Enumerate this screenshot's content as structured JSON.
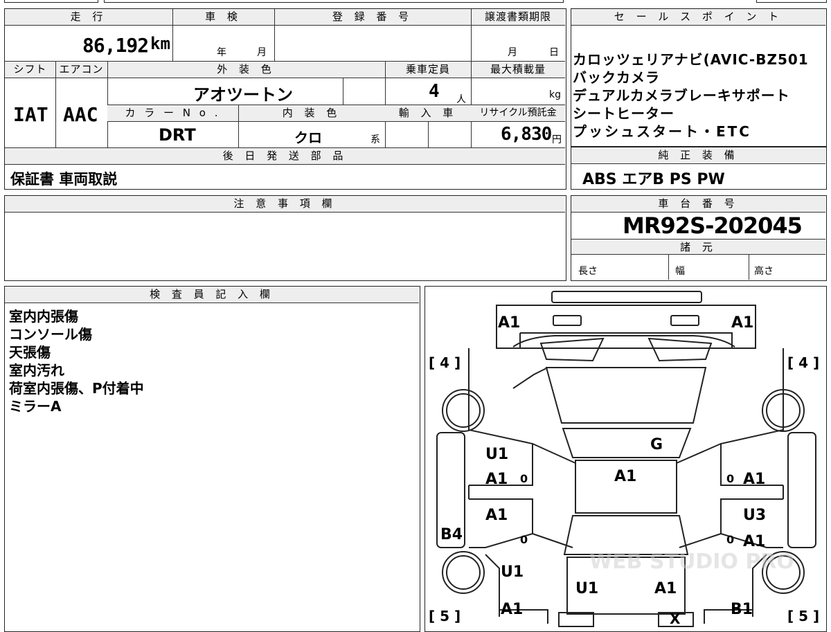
{
  "vehicle": {
    "headers": {
      "mileage": "走 行",
      "inspection": "車 検",
      "registration": "登 録 番 号",
      "transfer_deadline": "譲渡書類期限",
      "shift": "シフト",
      "aircon": "エアコン",
      "exterior_color": "外 装 色",
      "capacity": "乗車定員",
      "max_load": "最大積載量",
      "color_no": "カ ラ ー N o .",
      "interior_color": "内 装 色",
      "import": "輸 入 車",
      "recycle_fee": "リサイクル預託金"
    },
    "mileage": "86,192",
    "mileage_unit": "km",
    "inspection_year": "年",
    "inspection_month": "月",
    "deadline_month": "月",
    "deadline_day": "日",
    "shift": "IAT",
    "aircon": "AAC",
    "exterior_color": "アオツートン",
    "capacity": "4",
    "capacity_unit": "人",
    "max_load_unit": "kg",
    "color_no": "DRT",
    "interior_color": "クロ",
    "interior_suffix": "系",
    "recycle_fee": "6,830",
    "recycle_unit": "円"
  },
  "later_parts": {
    "header": "後 日 発 送 部 品",
    "value": "保証書 車両取説"
  },
  "selling_points": {
    "header": "セ ー ル ス ポ イ ン ト",
    "lines": [
      "カロッツェリアナビ(AVIC-BZ501",
      "バックカメラ",
      "デュアルカメラブレーキサポート",
      "シートヒーター",
      "プッシュスタート・ETC"
    ]
  },
  "standard_equipment": {
    "header": "純 正 装 備",
    "value": "ABS エアB PS PW"
  },
  "caution": {
    "header": "注 意 事 項 欄"
  },
  "chassis": {
    "header": "車 台 番 号",
    "value": "MR92S-202045"
  },
  "specs": {
    "header": "諸 元",
    "length": "長さ",
    "width": "幅",
    "height": "高さ"
  },
  "inspector": {
    "header": "検 査 員 記 入 欄",
    "lines": [
      "室内内張傷",
      "コンソール傷",
      "天張傷",
      "室内汚れ",
      "荷室内張傷、P付着中",
      "ミラーA"
    ]
  },
  "diagram": {
    "tire_left_front": "[ 4 ]",
    "tire_right_front": "[ 4 ]",
    "tire_left_rear": "[ 5 ]",
    "tire_right_rear": "[ 5 ]",
    "marks": {
      "bumper_front_left": "A1",
      "bumper_front_right": "A1",
      "windshield": "G",
      "roof": "A1",
      "left_front_door_1": "U1",
      "left_front_door_2": "A1",
      "left_rear_door": "A1",
      "left_rocker": "B4",
      "left_rear_fender": "U1",
      "left_rear_corner": "A1",
      "right_front_door": "A1",
      "right_rear_door_1": "U3",
      "right_rear_door_2": "A1",
      "rear_left": "U1",
      "rear_right": "A1",
      "right_rear_corner": "B1",
      "rear_x": "X",
      "zero_1": "0",
      "zero_2": "0",
      "zero_3": "0",
      "zero_4": "0"
    },
    "watermark": "WEB STUDIO PRO"
  }
}
